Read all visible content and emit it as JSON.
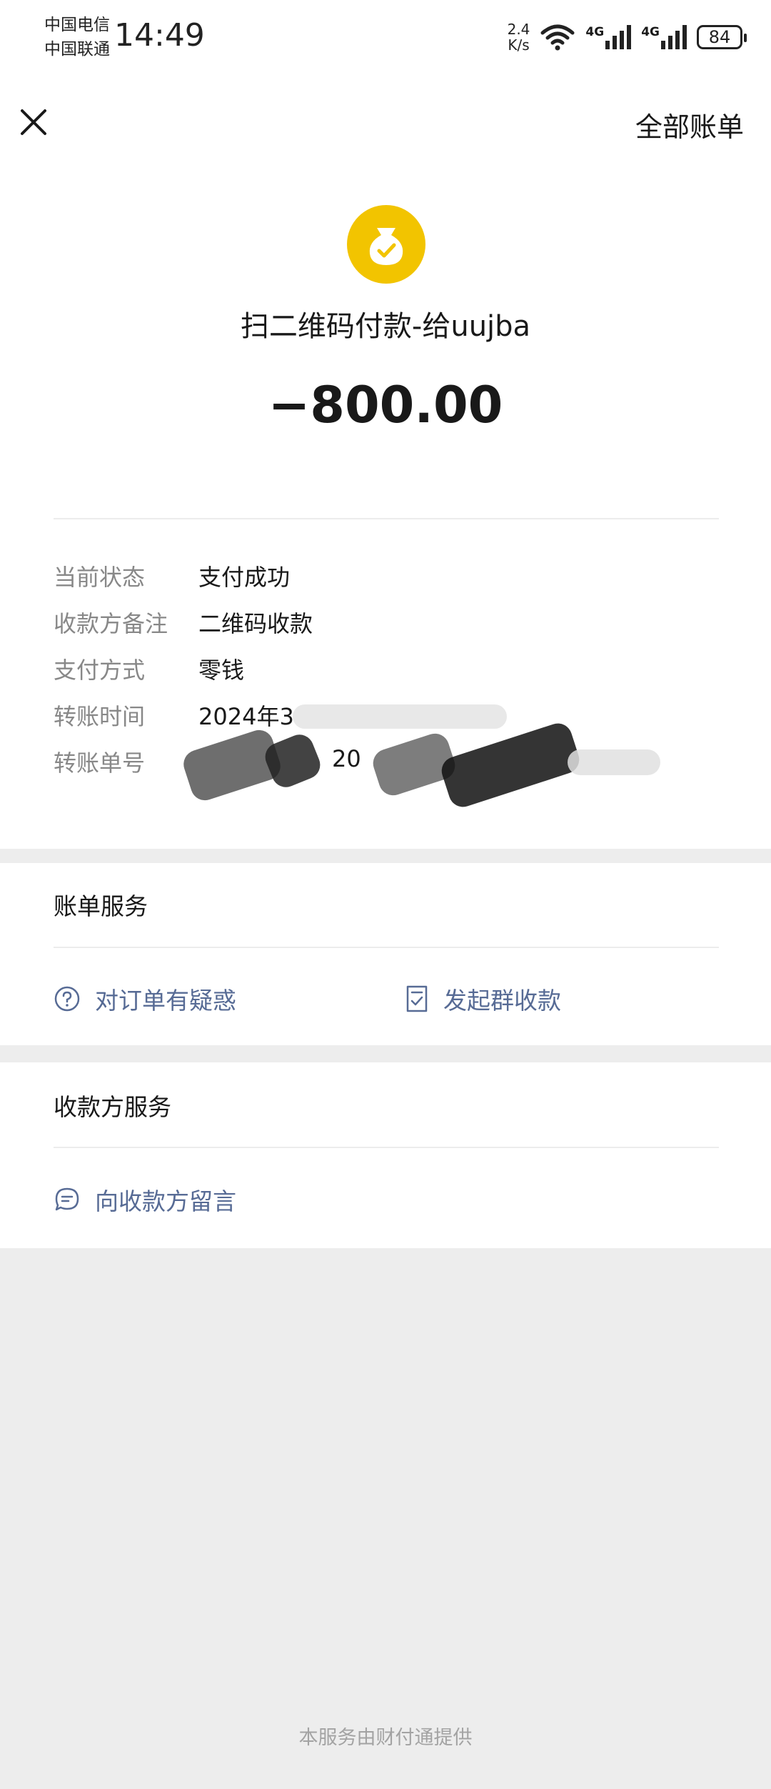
{
  "status_bar": {
    "carrier1": "中国电信",
    "carrier2": "中国联通",
    "time": "14:49",
    "net_speed_value": "2.4",
    "net_speed_unit": "K/s",
    "signal1_label": "4G",
    "signal2_label": "4G",
    "battery": "84"
  },
  "nav": {
    "close_icon": "close-icon",
    "all_bills": "全部账单"
  },
  "transaction": {
    "icon": "money-bag-check-icon",
    "icon_color": "#f2c400",
    "title": "扫二维码付款-给uujba",
    "amount": "−800.00"
  },
  "details": [
    {
      "label": "当前状态",
      "value": "支付成功"
    },
    {
      "label": "收款方备注",
      "value": "二维码收款"
    },
    {
      "label": "支付方式",
      "value": "零钱"
    },
    {
      "label": "转账时间",
      "value": "2024年3"
    },
    {
      "label": "转账单号",
      "value": "20"
    }
  ],
  "bill_service": {
    "title": "账单服务",
    "actions": [
      {
        "icon": "question-circle-icon",
        "label": "对订单有疑惑"
      },
      {
        "icon": "receipt-check-icon",
        "label": "发起群收款"
      }
    ]
  },
  "payee_service": {
    "title": "收款方服务",
    "actions": [
      {
        "icon": "message-bubble-icon",
        "label": "向收款方留言"
      }
    ]
  },
  "footer": "本服务由财付通提供",
  "colors": {
    "link": "#576b95",
    "label_gray": "#888888",
    "page_bg": "#ededed"
  }
}
